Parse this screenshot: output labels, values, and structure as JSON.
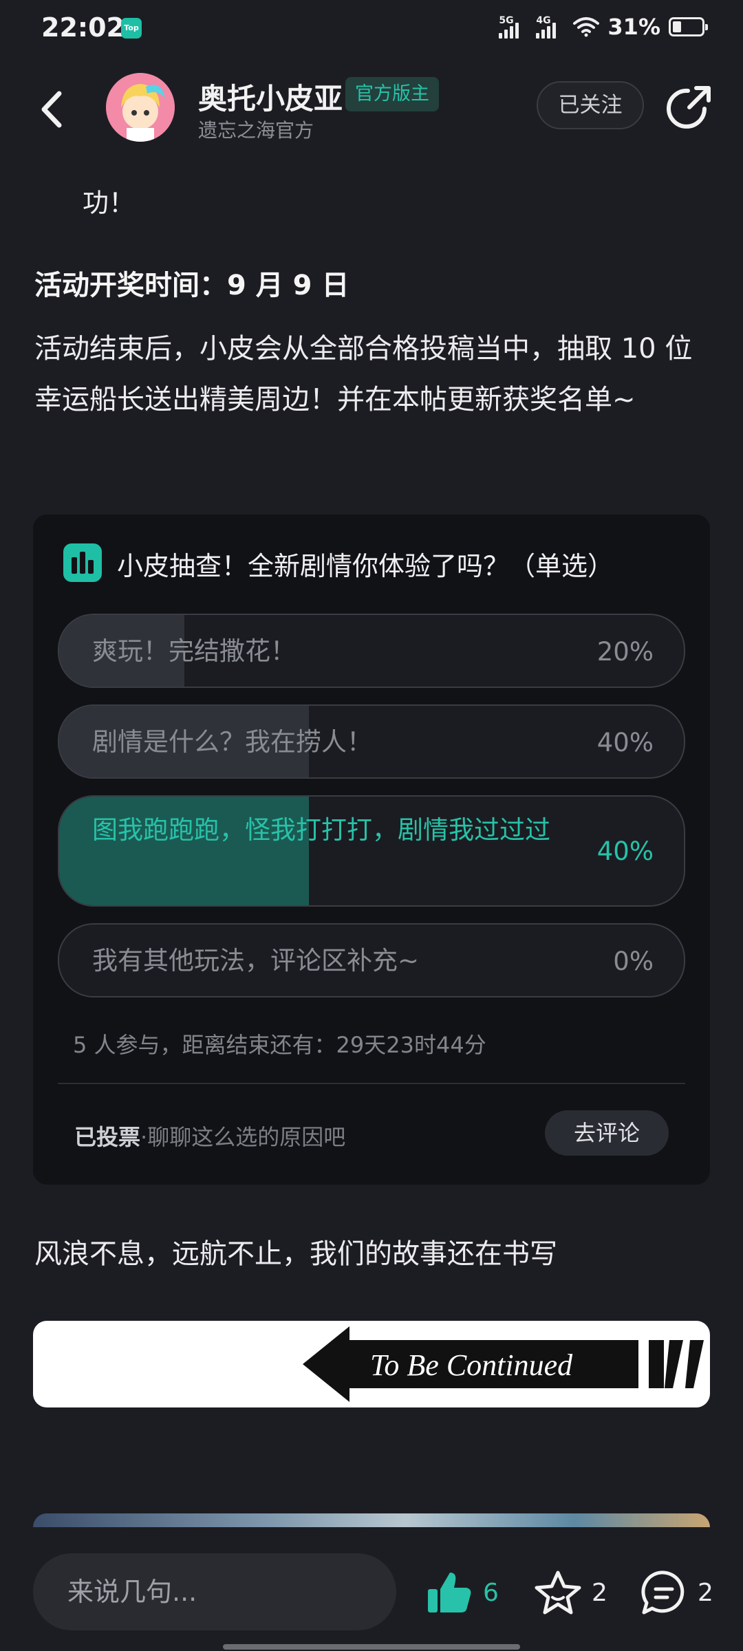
{
  "status_bar": {
    "time": "22:02",
    "app_badge": "Top",
    "network_1": "5G",
    "network_2": "4G",
    "battery": "31%",
    "battery_level": 0.31
  },
  "header": {
    "username": "奥托小皮亚",
    "badge": "官方版主",
    "subtitle": "遗忘之海官方",
    "follow_label": "已关注"
  },
  "post": {
    "cut_line": "功！",
    "prize_heading": "活动开奖时间：9 月 9 日",
    "prize_text": "活动结束后，小皮会从全部合格投稿当中，抽取 10 位幸运船长送出精美周边！并在本帖更新获奖名单~",
    "closing_text": "风浪不息，远航不止，我们的故事还在书写",
    "banner_text": "To Be Continued"
  },
  "poll": {
    "title": "小皮抽查！全新剧情你体验了吗？（单选）",
    "options": [
      {
        "label": "爽玩！完结撒花！",
        "percent": "20%",
        "value": 0.2,
        "selected": false
      },
      {
        "label": "剧情是什么？我在捞人！",
        "percent": "40%",
        "value": 0.4,
        "selected": false
      },
      {
        "label": "图我跑跑跑，怪我打打打，剧情我过过过",
        "percent": "40%",
        "value": 0.4,
        "selected": true
      },
      {
        "label": "我有其他玩法，评论区补充~",
        "percent": "0%",
        "value": 0.0,
        "selected": false
      }
    ],
    "meta": "5 人参与，距离结束还有：29天23时44分",
    "voted_label": "已投票",
    "voted_sub": "·聊聊这么选的原因吧",
    "comment_button": "去评论"
  },
  "bottom_bar": {
    "input_placeholder": "来说几句...",
    "like_count": "6",
    "favorite_count": "2",
    "comment_count": "2"
  },
  "colors": {
    "accent": "#27c2a9",
    "background": "#1c1d22",
    "card": "#111215"
  }
}
